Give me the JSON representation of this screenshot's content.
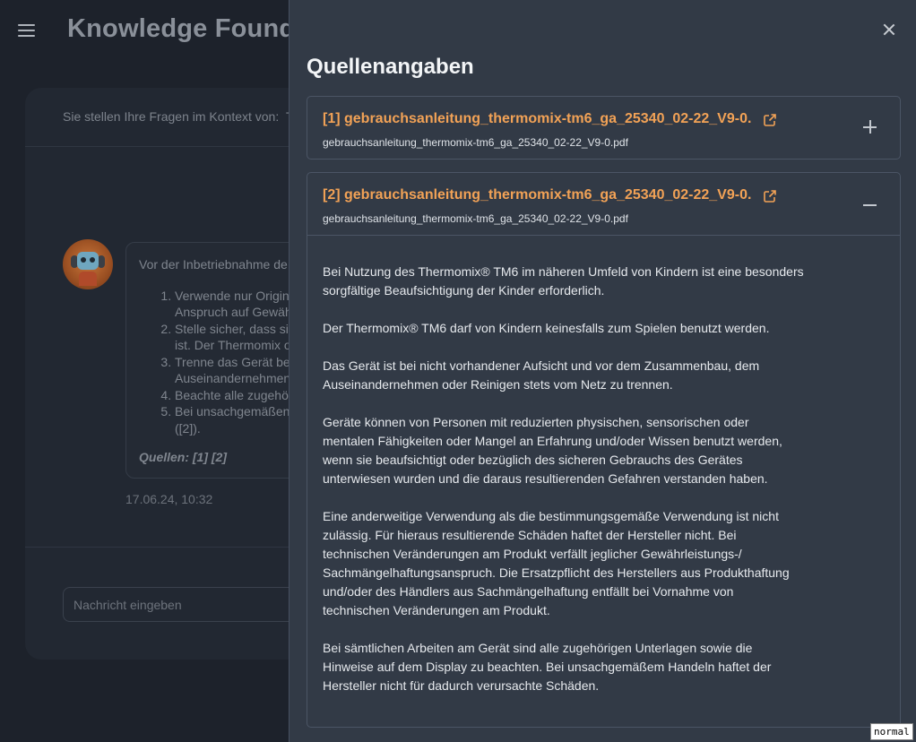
{
  "header": {
    "menu_icon": "hamburger-menu-icon",
    "app_title": "Knowledge Foundation"
  },
  "chat": {
    "context_label": "Sie stellen Ihre Fragen im Kontext von:",
    "context_value": "T",
    "message": {
      "intro": "Vor der Inbetriebnahme de",
      "items": [
        {
          "line1": "Verwende nur Origin",
          "line2": "Anspruch auf Gewäh"
        },
        {
          "line1": "Stelle sicher, dass si",
          "line2": "ist. Der Thermomix o"
        },
        {
          "line1": "Trenne das Gerät be",
          "line2": "Auseinandernehmen"
        },
        {
          "line1": "Beachte alle zugehö",
          "line2": ""
        },
        {
          "line1": "Bei unsachgemäßen",
          "line2": "([2])."
        }
      ],
      "sources": "Quellen: [1] [2]"
    },
    "timestamp": "17.06.24, 10:32",
    "input_placeholder": "Nachricht eingeben"
  },
  "drawer": {
    "title": "Quellenangaben",
    "close_icon": "close-icon",
    "sources": [
      {
        "title": "[1] gebrauchsanleitung_thermomix-tm6_ga_25340_02-22_V9-0.",
        "file": "gebrauchsanleitung_thermomix-tm6_ga_25340_02-22_V9-0.pdf",
        "expanded": false
      },
      {
        "title": "[2] gebrauchsanleitung_thermomix-tm6_ga_25340_02-22_V9-0.",
        "file": "gebrauchsanleitung_thermomix-tm6_ga_25340_02-22_V9-0.pdf",
        "expanded": true,
        "paragraphs": [
          [
            "Bei Nutzung des Thermomix® TM6 im näheren Umfeld von Kindern ist eine besonders",
            "sorgfältige Beaufsichtigung der Kinder erforderlich."
          ],
          [
            "Der Thermomix® TM6 darf von Kindern keinesfalls zum Spielen benutzt werden."
          ],
          [
            "Das Gerät ist bei nicht vorhandener Aufsicht und vor dem Zusammenbau, dem",
            "Auseinandernehmen oder Reinigen stets vom Netz zu trennen."
          ],
          [
            "Geräte können von Personen mit reduzierten physischen, sensorischen oder",
            "mentalen Fähigkeiten oder Mangel an Erfahrung und/oder Wissen benutzt werden,",
            "wenn sie beaufsichtigt oder bezüglich des sicheren Gebrauchs des Gerätes",
            "unterwiesen wurden und die daraus resultierenden Gefahren verstanden haben."
          ],
          [
            "Eine anderweitige Verwendung als die bestimmungsgemäße Verwendung ist nicht",
            "zulässig. Für hieraus resultierende Schäden haftet der Hersteller nicht. Bei",
            "technischen Veränderungen am Produkt verfällt jeglicher Gewährleistungs-/",
            "Sachmängelhaftungsanspruch. Die Ersatzpflicht des Herstellers aus Produkthaftung",
            "und/oder des Händlers aus Sachmängelhaftung entfällt bei Vornahme von",
            "technischen Veränderungen am Produkt."
          ],
          [
            "Bei sämtlichen Arbeiten am Gerät sind alle zugehörigen Unterlagen sowie die",
            "Hinweise auf dem Display zu beachten. Bei unsachgemäßem Handeln haftet der",
            "Hersteller nicht für dadurch verursachte Schäden."
          ]
        ]
      }
    ]
  },
  "mode_tag": "normal",
  "colors": {
    "accent": "#f2a256",
    "drawer_bg": "#323a46",
    "app_bg": "#1d222b"
  }
}
